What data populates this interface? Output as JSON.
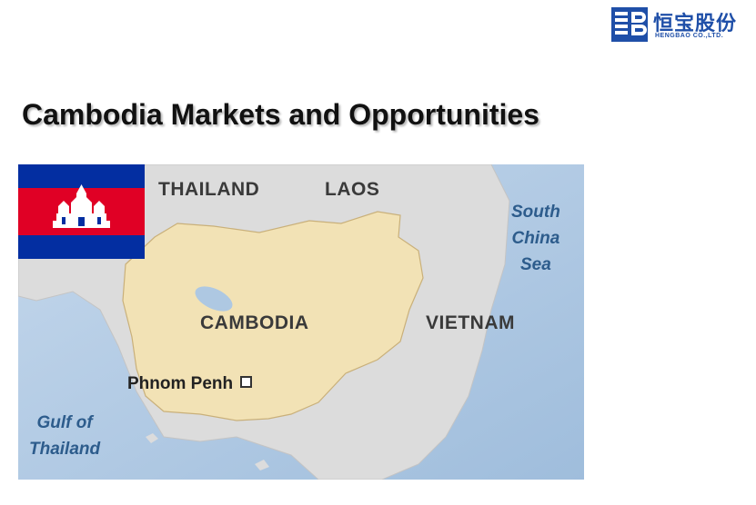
{
  "logo": {
    "chinese_name": "恒宝股份",
    "english_name": "HENGBAO CO.,LTD.",
    "brand_color": "#1f4fa8",
    "icon": "hengbao-logo-icon"
  },
  "slide": {
    "title": "Cambodia Markets and Opportunities"
  },
  "map": {
    "labels": {
      "thailand": "THAILAND",
      "laos": "LAOS",
      "cambodia": "CAMBODIA",
      "vietnam": "VIETNAM",
      "capital": "Phnom Penh",
      "south_china_sea": "South\nChina\nSea",
      "gulf_of_thailand": "Gulf of\nThailand"
    },
    "colors": {
      "land": "#dcdcdc",
      "cambodia": "#f2e2b5",
      "sea": "#aec8e2",
      "water_text": "#2d5c8c"
    },
    "inset_icon": "region-locator-inset",
    "flag_icon": "cambodia-flag-icon",
    "flag_colors": {
      "blue": "#032ea1",
      "red": "#e00025",
      "white": "#ffffff"
    }
  }
}
